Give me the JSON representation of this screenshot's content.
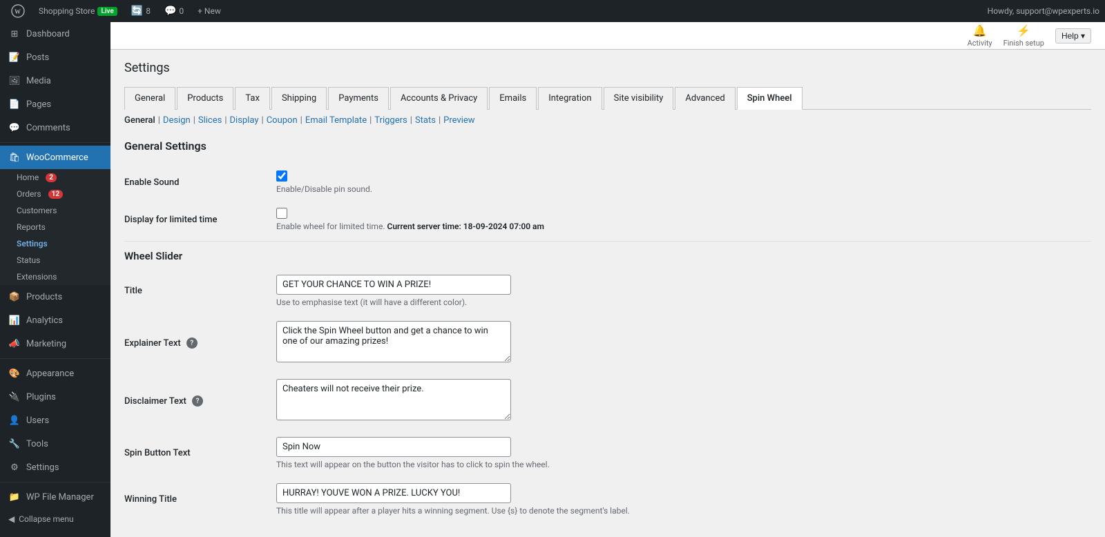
{
  "adminbar": {
    "site_name": "Shopping Store",
    "live_label": "Live",
    "updates_count": "8",
    "comments_count": "0",
    "new_label": "+ New",
    "user_greeting": "Howdy, support@wpexperts.io"
  },
  "topbar": {
    "activity_label": "Activity",
    "finish_setup_label": "Finish setup",
    "help_label": "Help ▾"
  },
  "sidebar": {
    "dashboard": "Dashboard",
    "posts": "Posts",
    "media": "Media",
    "pages": "Pages",
    "comments": "Comments",
    "woocommerce": "WooCommerce",
    "woo_home": "Home",
    "woo_home_badge": "2",
    "woo_orders": "Orders",
    "woo_orders_badge": "12",
    "woo_customers": "Customers",
    "woo_reports": "Reports",
    "woo_settings": "Settings",
    "woo_status": "Status",
    "woo_extensions": "Extensions",
    "products": "Products",
    "analytics": "Analytics",
    "marketing": "Marketing",
    "appearance": "Appearance",
    "plugins": "Plugins",
    "users": "Users",
    "tools": "Tools",
    "settings": "Settings",
    "wp_file_manager": "WP File Manager",
    "collapse_menu": "Collapse menu"
  },
  "page": {
    "title": "Settings"
  },
  "tabs": [
    {
      "label": "General",
      "active": false
    },
    {
      "label": "Products",
      "active": false
    },
    {
      "label": "Tax",
      "active": false
    },
    {
      "label": "Shipping",
      "active": false
    },
    {
      "label": "Payments",
      "active": false
    },
    {
      "label": "Accounts & Privacy",
      "active": false
    },
    {
      "label": "Emails",
      "active": false
    },
    {
      "label": "Integration",
      "active": false
    },
    {
      "label": "Site visibility",
      "active": false
    },
    {
      "label": "Advanced",
      "active": false
    },
    {
      "label": "Spin Wheel",
      "active": true
    }
  ],
  "subnav": [
    {
      "label": "General",
      "current": true
    },
    {
      "label": "Design",
      "current": false
    },
    {
      "label": "Slices",
      "current": false
    },
    {
      "label": "Display",
      "current": false
    },
    {
      "label": "Coupon",
      "current": false
    },
    {
      "label": "Email Template",
      "current": false
    },
    {
      "label": "Triggers",
      "current": false
    },
    {
      "label": "Stats",
      "current": false
    },
    {
      "label": "Preview",
      "current": false
    }
  ],
  "sections": {
    "general_settings": "General Settings",
    "wheel_slider": "Wheel Slider"
  },
  "fields": {
    "enable_sound": {
      "label": "Enable Sound",
      "checked": true,
      "description": "Enable/Disable pin sound."
    },
    "display_limited_time": {
      "label": "Display for limited time",
      "checked": false,
      "description_prefix": "Enable wheel for limited time.",
      "description_time_label": "Current server time: 18-09-2024 07:00 am"
    },
    "title": {
      "label": "Title",
      "value": "GET YOUR CHANCE TO WIN A PRIZE!",
      "description": "Use to emphasise text (it will have a different color)."
    },
    "explainer_text": {
      "label": "Explainer Text",
      "value": "Click the Spin Wheel button and get a chance to win one of our amazing prizes!",
      "has_help": true
    },
    "disclaimer_text": {
      "label": "Disclaimer Text",
      "value": "Cheaters will not receive their prize.",
      "has_help": true
    },
    "spin_button_text": {
      "label": "Spin Button Text",
      "value": "Spin Now",
      "description": "This text will appear on the button the visitor has to click to spin the wheel."
    },
    "winning_title": {
      "label": "Winning Title",
      "value": "HURRAY! YOUVE WON A PRIZE. LUCKY YOU!",
      "description": "This title will appear after a player hits a winning segment. Use {s} to denote the segment's label."
    }
  }
}
